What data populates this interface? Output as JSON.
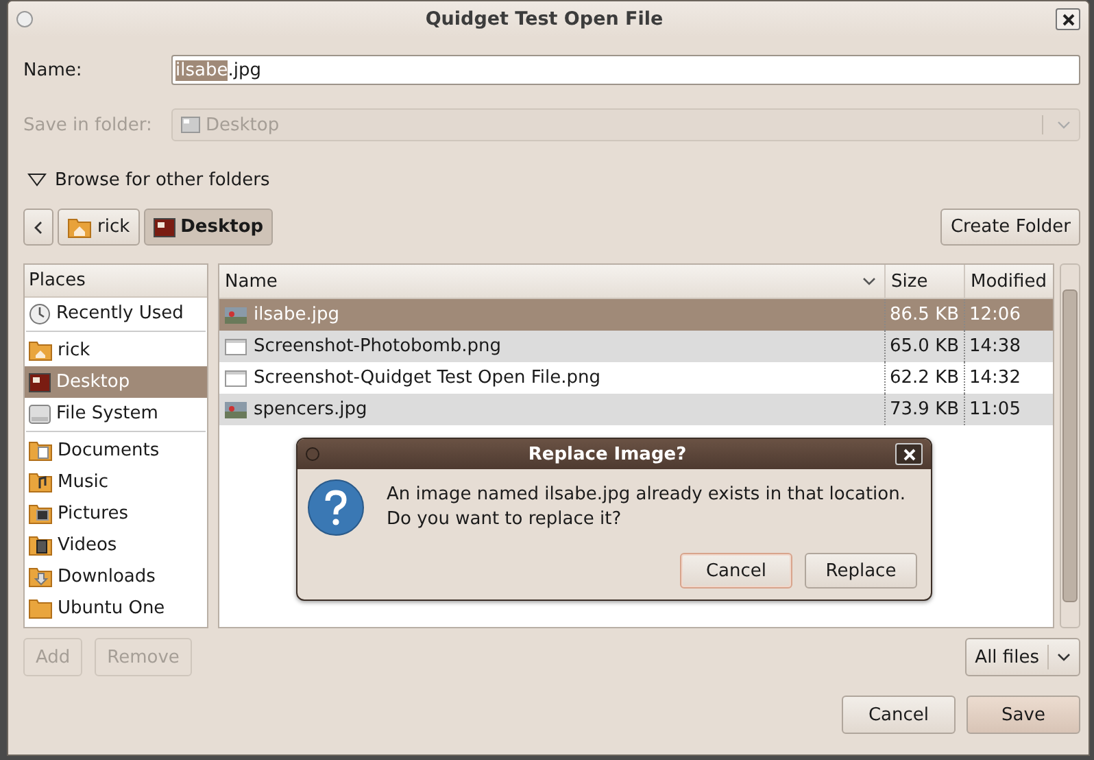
{
  "window": {
    "title": "Quidget Test Open File"
  },
  "name_field": {
    "label": "Name:",
    "selected_text": "ilsabe",
    "unselected_text": ".jpg"
  },
  "save_in_folder": {
    "label": "Save in folder:",
    "value": "Desktop",
    "disabled": true
  },
  "browse_expander": {
    "label": "Browse for other folders",
    "expanded": true
  },
  "path_bar": [
    {
      "label": "rick",
      "kind": "home",
      "selected": false
    },
    {
      "label": "Desktop",
      "kind": "desktop",
      "selected": true
    }
  ],
  "create_folder_button": "Create Folder",
  "places": {
    "header": "Places",
    "groups": [
      [
        {
          "label": "Recently Used",
          "kind": "recent",
          "selected": false
        }
      ],
      [
        {
          "label": "rick",
          "kind": "home",
          "selected": false
        },
        {
          "label": "Desktop",
          "kind": "desktop",
          "selected": true
        },
        {
          "label": "File System",
          "kind": "drive",
          "selected": false
        }
      ],
      [
        {
          "label": "Documents",
          "kind": "documents",
          "selected": false
        },
        {
          "label": "Music",
          "kind": "music",
          "selected": false
        },
        {
          "label": "Pictures",
          "kind": "pictures",
          "selected": false
        },
        {
          "label": "Videos",
          "kind": "videos",
          "selected": false
        },
        {
          "label": "Downloads",
          "kind": "downloads",
          "selected": false
        },
        {
          "label": "Ubuntu One",
          "kind": "folder",
          "selected": false
        }
      ]
    ]
  },
  "files": {
    "columns": [
      "Name",
      "Size",
      "Modified"
    ],
    "rows": [
      {
        "name": "ilsabe.jpg",
        "size": "86.5 KB",
        "modified": "12:06",
        "kind": "image",
        "selected": true
      },
      {
        "name": "Screenshot-Photobomb.png",
        "size": "65.0 KB",
        "modified": "14:38",
        "kind": "document",
        "selected": false
      },
      {
        "name": "Screenshot-Quidget Test Open File.png",
        "size": "62.2 KB",
        "modified": "14:32",
        "kind": "document",
        "selected": false
      },
      {
        "name": "spencers.jpg",
        "size": "73.9 KB",
        "modified": "11:05",
        "kind": "image",
        "selected": false
      }
    ]
  },
  "places_buttons": [
    {
      "label": "Add",
      "disabled": true
    },
    {
      "label": "Remove",
      "disabled": true
    }
  ],
  "filter": {
    "value": "All files"
  },
  "buttons": [
    {
      "label": "Cancel",
      "focused": false
    },
    {
      "label": "Save",
      "focused": true
    }
  ],
  "dialog": {
    "title": "Replace Image?",
    "message": [
      "An image named ilsabe.jpg already exists in that location.",
      "Do you want to replace it?"
    ],
    "buttons": [
      {
        "label": "Cancel",
        "focused": true
      },
      {
        "label": "Replace",
        "focused": false
      }
    ]
  }
}
